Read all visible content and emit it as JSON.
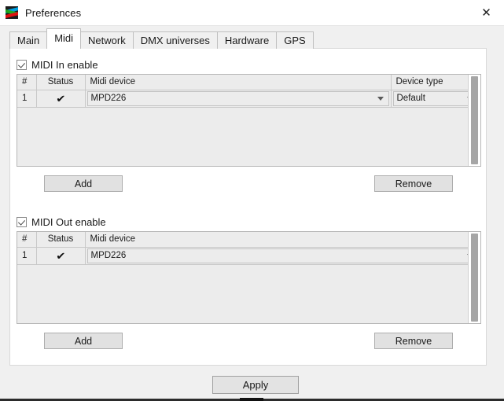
{
  "window": {
    "title": "Preferences",
    "icon": "app-logo-icon",
    "close_label": "✕"
  },
  "tabs": [
    {
      "label": "Main",
      "active": false
    },
    {
      "label": "Midi",
      "active": true
    },
    {
      "label": "Network",
      "active": false
    },
    {
      "label": "DMX universes",
      "active": false
    },
    {
      "label": "Hardware",
      "active": false
    },
    {
      "label": "GPS",
      "active": false
    }
  ],
  "midi_in": {
    "enable_label": "MIDI In enable",
    "enabled": true,
    "columns": [
      "#",
      "Status",
      "Midi device",
      "Device type"
    ],
    "rows": [
      {
        "num": "1",
        "status": "✔",
        "device": "MPD226",
        "device_type": "Default"
      }
    ],
    "add_label": "Add",
    "remove_label": "Remove"
  },
  "midi_out": {
    "enable_label": "MIDI Out enable",
    "enabled": true,
    "columns": [
      "#",
      "Status",
      "Midi device"
    ],
    "rows": [
      {
        "num": "1",
        "status": "✔",
        "device": "MPD226"
      }
    ],
    "add_label": "Add",
    "remove_label": "Remove"
  },
  "footer": {
    "apply_label": "Apply"
  },
  "colors": {
    "dialog_bg": "#f0f0f0",
    "panel_bg": "#ffffff",
    "table_bg": "#ececec",
    "button_bg": "#e1e1e1",
    "border": "#b6b6b6",
    "scroll_thumb": "#a6a6a6"
  }
}
